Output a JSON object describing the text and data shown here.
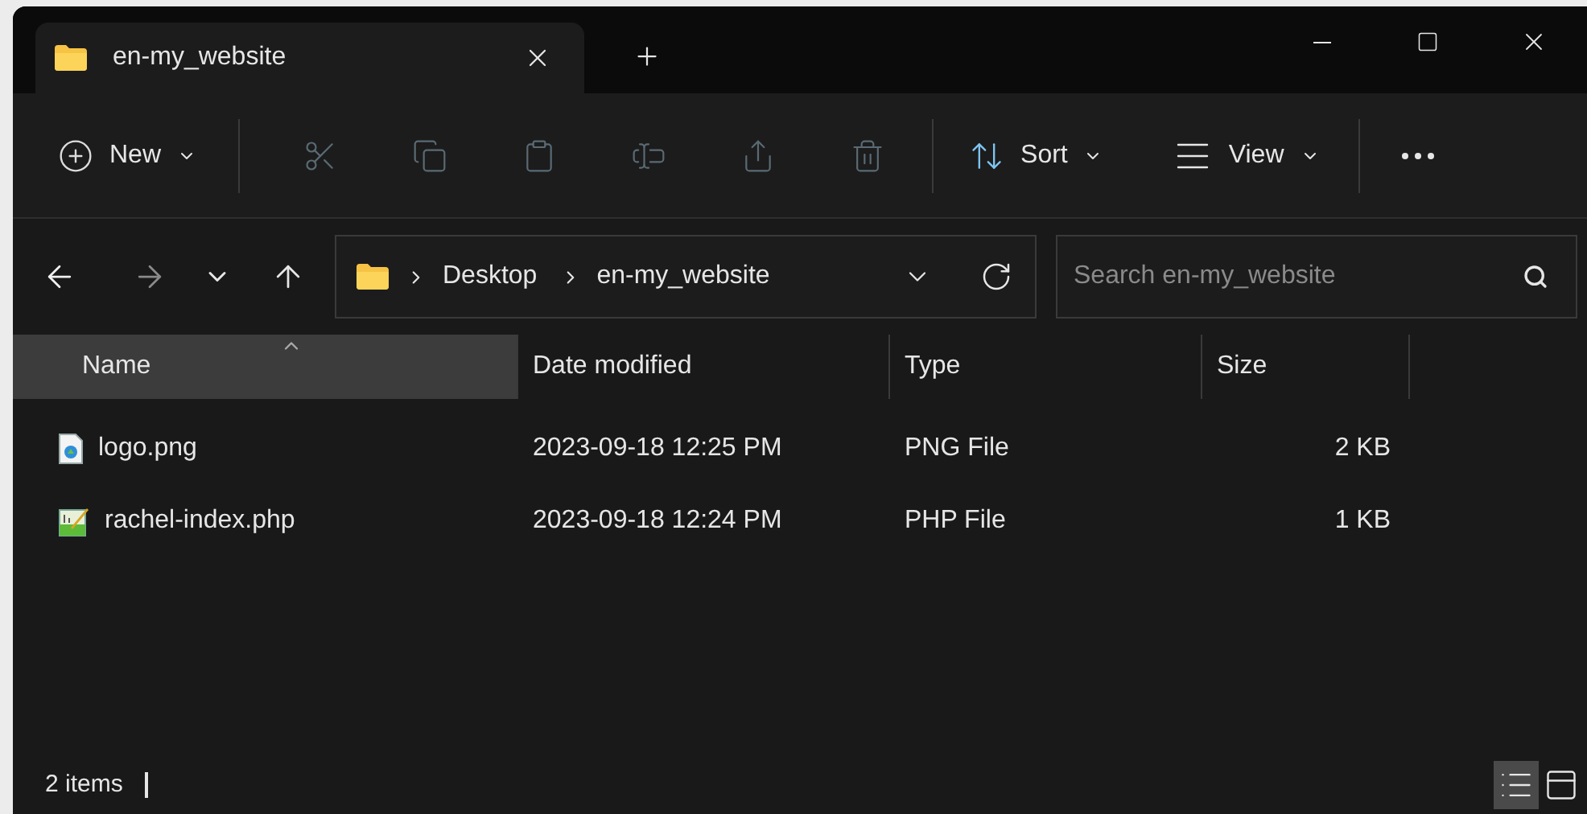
{
  "tabs": [
    {
      "title": "en-my_website",
      "selected": true
    }
  ],
  "toolbar": {
    "new": {
      "label": "New"
    },
    "actions": [
      {
        "disabled": true
      },
      {
        "disabled": true
      },
      {
        "disabled": true
      },
      {
        "disabled": true
      },
      {
        "disabled": true
      },
      {
        "disabled": true
      }
    ],
    "sort": {
      "label": "Sort"
    },
    "view": {
      "label": "View"
    }
  },
  "nav": {
    "back": {
      "disabled": false
    },
    "forward": {
      "disabled": true
    }
  },
  "address": {
    "crumbs": [
      "Desktop",
      "en-my_website"
    ]
  },
  "search": {
    "placeholder": "Search en-my_website"
  },
  "table": {
    "columns": [
      {
        "label": "Name",
        "selected": true
      },
      {
        "label": "Date modified",
        "selected": false
      },
      {
        "label": "Type",
        "selected": false
      },
      {
        "label": "Size",
        "selected": false
      }
    ],
    "rows": [
      {
        "kind": "image",
        "name": "logo.png",
        "date": "2023-09-18 12:25 PM",
        "type": "PNG File",
        "size": "2 KB"
      },
      {
        "kind": "script",
        "name": "rachel-index.php",
        "date": "2023-09-18 12:24 PM",
        "type": "PHP File",
        "size": "1 KB"
      }
    ]
  },
  "status_bar": {
    "count": "2 items",
    "views": [
      {
        "selected": true
      },
      {
        "selected": false
      }
    ]
  }
}
